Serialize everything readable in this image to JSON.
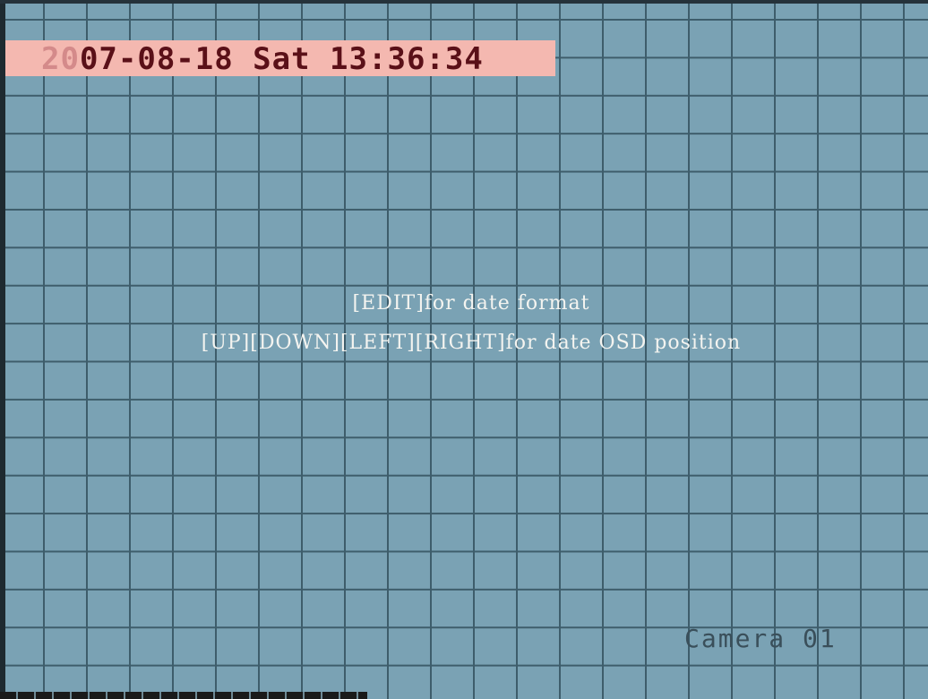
{
  "osd": {
    "date_prefix": "20",
    "date_rest": "07-08-18 Sat 13:36:34",
    "hint_line_1": "[EDIT]for date format",
    "hint_line_2": "[UP][DOWN][LEFT][RIGHT]for date OSD position",
    "camera_label": "Camera 01"
  },
  "colors": {
    "background": "#7aa2b4",
    "grid_line": "#3e5d6b",
    "date_bar": "#f4b8b0",
    "date_text": "#5a1018",
    "hint_text": "#f4f4f0",
    "camera_text": "#3a4f5a"
  }
}
